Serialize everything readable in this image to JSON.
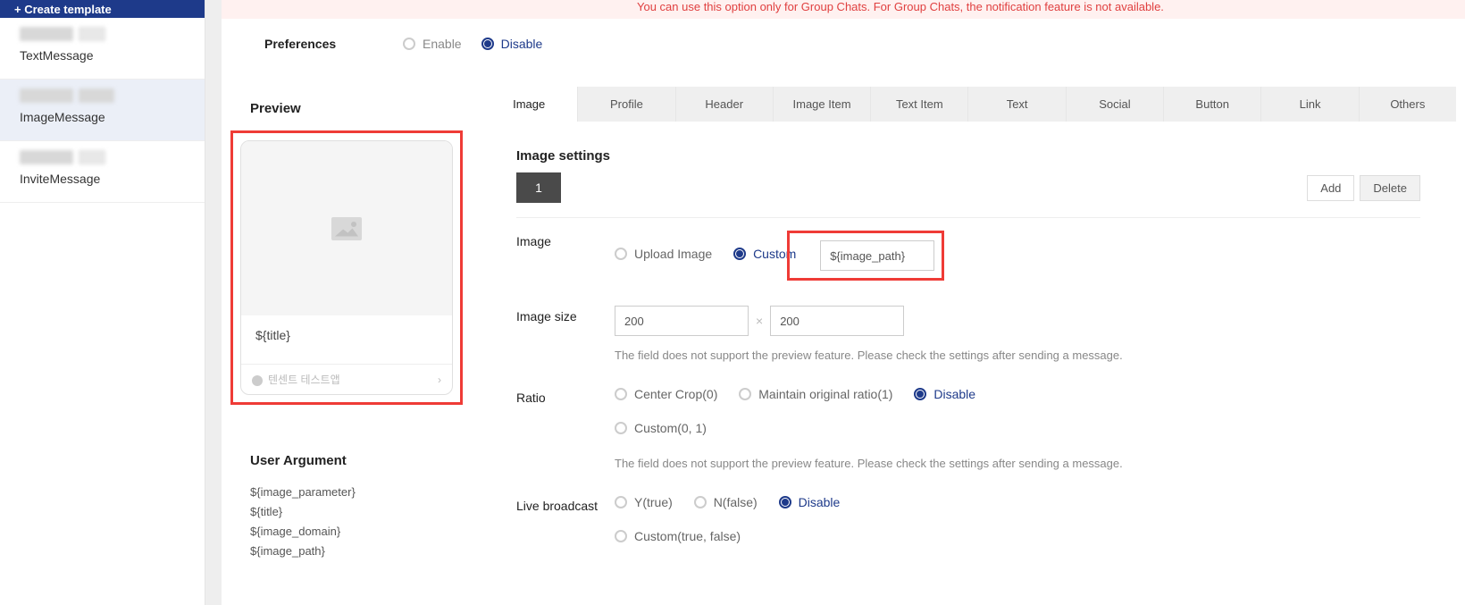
{
  "sidebar": {
    "create_label": "+ Create template",
    "items": [
      {
        "label": "TextMessage"
      },
      {
        "label": "ImageMessage"
      },
      {
        "label": "InviteMessage"
      }
    ]
  },
  "banner": {
    "warn": "You can use this option only for Group Chats. For Group Chats, the notification feature is not available."
  },
  "preferences": {
    "label": "Preferences",
    "enable": "Enable",
    "disable": "Disable"
  },
  "preview": {
    "title": "Preview",
    "card_title": "${title}",
    "footer": "텐센트 테스트앱"
  },
  "user_argument": {
    "title": "User Argument",
    "items": [
      "${image_parameter}",
      "${title}",
      "${image_domain}",
      "${image_path}"
    ]
  },
  "tabs": [
    "Image",
    "Profile",
    "Header",
    "Image Item",
    "Text Item",
    "Text",
    "Social",
    "Button",
    "Link",
    "Others"
  ],
  "settings": {
    "title": "Image settings",
    "seg": "1",
    "add": "Add",
    "delete": "Delete",
    "image": {
      "label": "Image",
      "upload": "Upload Image",
      "custom": "Custom",
      "value": "${image_path}"
    },
    "size": {
      "label": "Image size",
      "w": "200",
      "h": "200",
      "help": "The field does not support the preview feature. Please check the settings after sending a message."
    },
    "ratio": {
      "label": "Ratio",
      "center": "Center Crop(0)",
      "maintain": "Maintain original ratio(1)",
      "disable": "Disable",
      "custom": "Custom(0, 1)",
      "help": "The field does not support the preview feature. Please check the settings after sending a message."
    },
    "live": {
      "label": "Live broadcast",
      "y": "Y(true)",
      "n": "N(false)",
      "disable": "Disable",
      "custom": "Custom(true, false)"
    }
  }
}
